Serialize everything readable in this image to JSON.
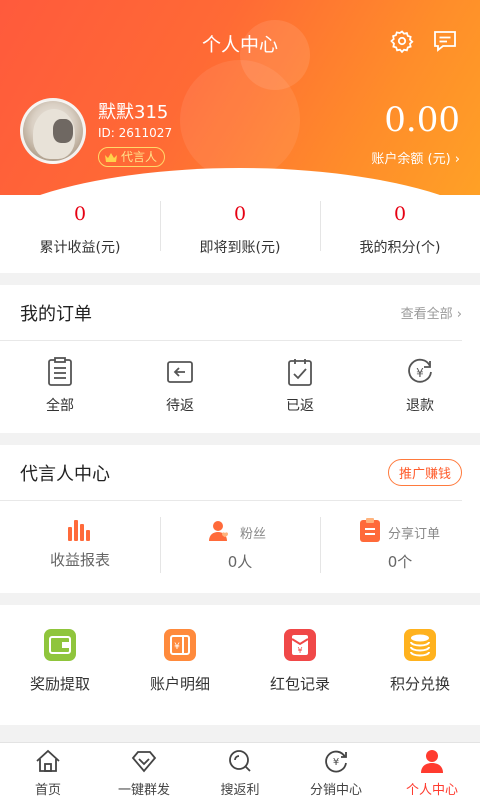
{
  "header": {
    "title": "个人中心",
    "nickname": "默默315",
    "user_id": "ID: 2611027",
    "badge": "代言人",
    "balance": "0.00",
    "balance_label": "账户余额 (元) ›"
  },
  "stats": [
    {
      "value": "0",
      "label": "累计收益(元)"
    },
    {
      "value": "0",
      "label": "即将到账(元)"
    },
    {
      "value": "0",
      "label": "我的积分(个)"
    }
  ],
  "orders": {
    "title": "我的订单",
    "view_all": "查看全部 ›",
    "items": [
      {
        "label": "全部",
        "icon": "list-icon"
      },
      {
        "label": "待返",
        "icon": "return-icon"
      },
      {
        "label": "已返",
        "icon": "check-clipboard-icon"
      },
      {
        "label": "退款",
        "icon": "refund-icon"
      }
    ]
  },
  "agent": {
    "title": "代言人中心",
    "promo_button": "推广赚钱",
    "report": {
      "label": "收益报表",
      "icon": "bar-chart-icon"
    },
    "fans": {
      "label": "粉丝",
      "value": "0人",
      "icon": "fans-icon"
    },
    "share_orders": {
      "label": "分享订单",
      "value": "0个",
      "icon": "share-order-icon"
    }
  },
  "tools": [
    {
      "label": "奖励提取",
      "icon": "wallet-icon",
      "color": "#8fc53c"
    },
    {
      "label": "账户明细",
      "icon": "ledger-icon",
      "color": "#ff8a3c"
    },
    {
      "label": "红包记录",
      "icon": "red-envelope-icon",
      "color": "#f04848"
    },
    {
      "label": "积分兑换",
      "icon": "coins-icon",
      "color": "#ffb21e"
    }
  ],
  "tabbar": [
    {
      "label": "首页",
      "icon": "home-icon",
      "active": false
    },
    {
      "label": "一键群发",
      "icon": "diamond-icon",
      "active": false
    },
    {
      "label": "搜返利",
      "icon": "search-icon",
      "active": false
    },
    {
      "label": "分销中心",
      "icon": "yuan-cycle-icon",
      "active": false
    },
    {
      "label": "个人中心",
      "icon": "person-icon",
      "active": true
    }
  ],
  "colors": {
    "accent": "#ff5a3c",
    "highlight": "#e60012",
    "active_tab": "#ff3b2f"
  }
}
